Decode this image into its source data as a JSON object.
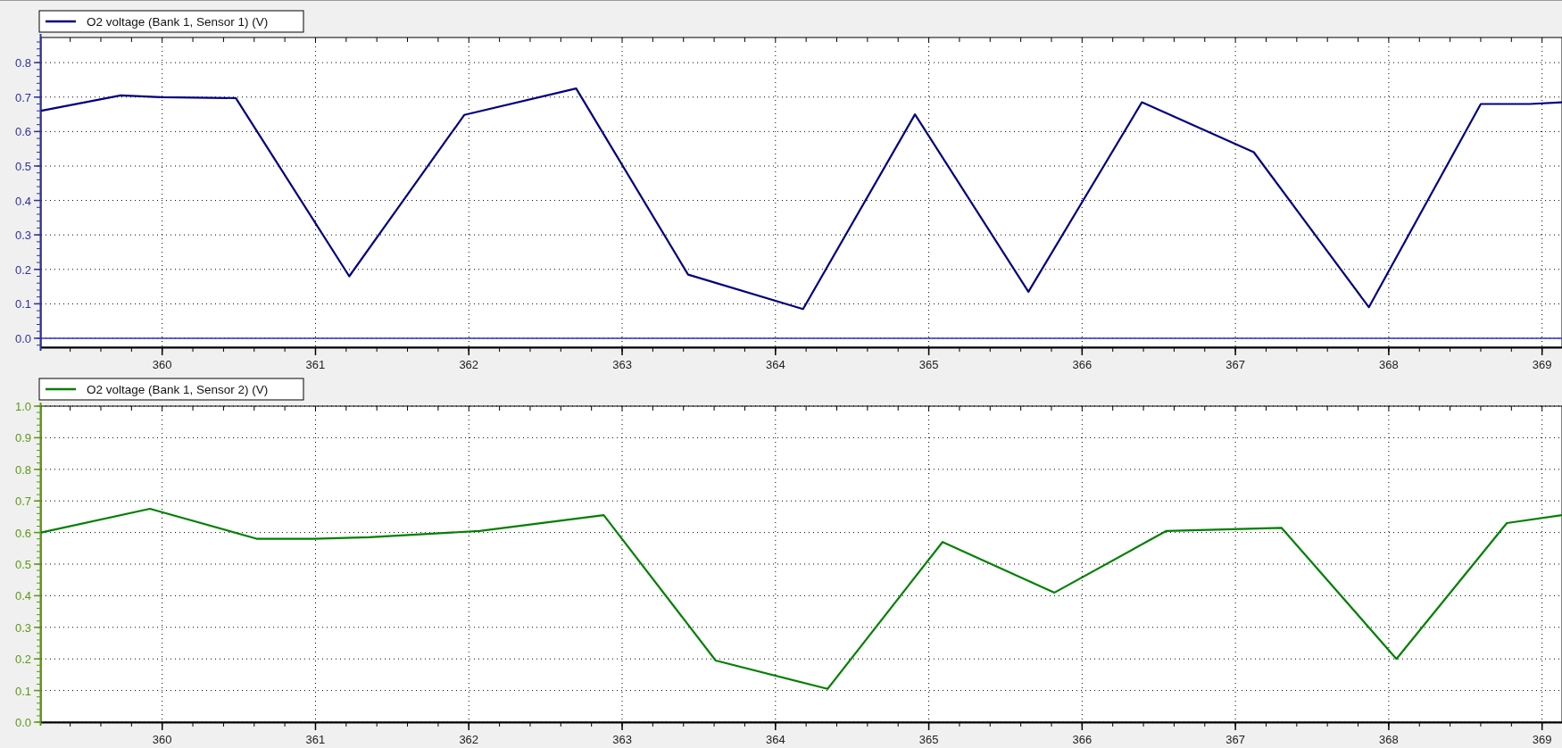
{
  "charts": [
    {
      "chart_data": {
        "type": "line",
        "grid": true,
        "xlim": [
          359.21,
          369.13
        ],
        "ylim": [
          -0.026,
          0.873
        ],
        "x": [
          359.21,
          359.73,
          359.99,
          360.48,
          361.22,
          361.97,
          362.7,
          363.43,
          364.18,
          364.91,
          365.65,
          366.39,
          367.12,
          367.87,
          368.6,
          368.92,
          369.13
        ],
        "series": [
          {
            "name": "O2 voltage (Bank 1, Sensor 1) (V)",
            "color": "#000080",
            "values": [
              0.66,
              0.705,
              0.7,
              0.697,
              0.18,
              0.648,
              0.725,
              0.185,
              0.085,
              0.65,
              0.135,
              0.685,
              0.54,
              0.09,
              0.68,
              0.68,
              0.685
            ]
          }
        ],
        "xticks": [
          360,
          361,
          362,
          363,
          364,
          365,
          366,
          367,
          368,
          369
        ],
        "yticks": [
          {
            "value": 0,
            "label": "0.0"
          },
          {
            "value": 0.1,
            "label": "0.1"
          },
          {
            "value": 0.2,
            "label": "0.2"
          },
          {
            "value": 0.3,
            "label": "0.3"
          },
          {
            "value": 0.4,
            "label": "0.4"
          },
          {
            "value": 0.5,
            "label": "0.5"
          },
          {
            "value": 0.6,
            "label": "0.6"
          },
          {
            "value": 0.7,
            "label": "0.7"
          },
          {
            "value": 0.8,
            "label": "0.8"
          }
        ],
        "ref_lines": [
          {
            "axis": "y",
            "value": 0
          }
        ]
      }
    },
    {
      "chart_data": {
        "type": "line",
        "grid": true,
        "xlim": [
          359.21,
          369.13
        ],
        "ylim": [
          0,
          1
        ],
        "x": [
          359.21,
          359.92,
          360.62,
          360.99,
          361.35,
          362.07,
          362.88,
          363.61,
          364.34,
          365.09,
          365.82,
          366.55,
          367.3,
          368.05,
          368.77,
          369.13
        ],
        "series": [
          {
            "name": "O2 voltage (Bank 1, Sensor 2) (V)",
            "color": "#008000",
            "values": [
              0.6,
              0.675,
              0.58,
              0.58,
              0.585,
              0.605,
              0.655,
              0.195,
              0.105,
              0.57,
              0.41,
              0.605,
              0.615,
              0.2,
              0.63,
              0.655
            ]
          }
        ],
        "xticks": [
          360,
          361,
          362,
          363,
          364,
          365,
          366,
          367,
          368,
          369
        ],
        "yticks": [
          {
            "value": 0,
            "label": "0.0"
          },
          {
            "value": 0.1,
            "label": "0.1"
          },
          {
            "value": 0.2,
            "label": "0.2"
          },
          {
            "value": 0.3,
            "label": "0.3"
          },
          {
            "value": 0.4,
            "label": "0.4"
          },
          {
            "value": 0.5,
            "label": "0.5"
          },
          {
            "value": 0.6,
            "label": "0.6"
          },
          {
            "value": 0.7,
            "label": "0.7"
          },
          {
            "value": 0.8,
            "label": "0.8"
          },
          {
            "value": 0.9,
            "label": "0.9"
          },
          {
            "value": 1,
            "label": "1.0"
          }
        ]
      }
    }
  ]
}
